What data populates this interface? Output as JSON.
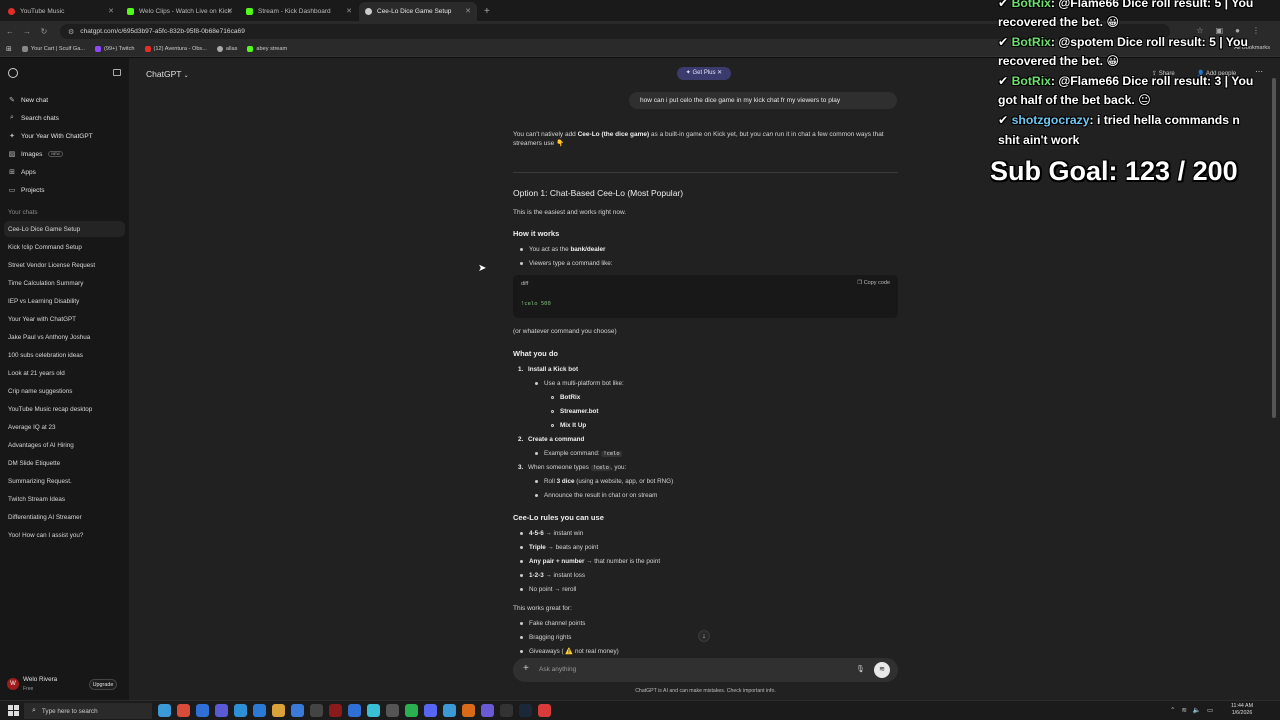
{
  "browser": {
    "tabs": [
      {
        "label": "YouTube Music",
        "color": "#e52d27",
        "active": false
      },
      {
        "label": "Welo Clips - Watch Live on Kick",
        "color": "#53fc18",
        "active": false
      },
      {
        "label": "Stream - Kick Dashboard",
        "color": "#53fc18",
        "active": false
      },
      {
        "label": "Cee-Lo Dice Game Setup",
        "color": "#cccccc",
        "active": true
      }
    ],
    "url": "chatgpt.com/c/695d3b97-a5fc-832b-95f8-0b68e716ca69",
    "bookmarks": [
      {
        "label": "Your Cart | Sculf Ga...",
        "color": "#888888"
      },
      {
        "label": "(99+) Twitch",
        "color": "#9146ff"
      },
      {
        "label": "(12) Aventura - Obs...",
        "color": "#e52d27"
      },
      {
        "label": "allas",
        "color": "#aaaaaa"
      },
      {
        "label": "abey stream",
        "color": "#53fc18"
      }
    ],
    "all_bookmarks": "All Bookmarks"
  },
  "sidebar": {
    "items": [
      {
        "label": "New chat",
        "icon": "edit-icon"
      },
      {
        "label": "Search chats",
        "icon": "search-icon"
      },
      {
        "label": "Your Year With ChatGPT",
        "icon": "sparkle-icon"
      },
      {
        "label": "Images",
        "icon": "image-icon",
        "badge": "NEW"
      },
      {
        "label": "Apps",
        "icon": "apps-icon"
      },
      {
        "label": "Projects",
        "icon": "folder-icon"
      }
    ],
    "section_label": "Your chats",
    "chats": [
      "Cee-Lo Dice Game Setup",
      "Kick !clip Command Setup",
      "Street Vendor License Request",
      "Time Calculation Summary",
      "IEP vs Learning Disability",
      "Your Year with ChatGPT",
      "Jake Paul vs Anthony Joshua",
      "100 subs celebration ideas",
      "Look at 21 years old",
      "Crip name suggestions",
      "YouTube Music recap desktop",
      "Average IQ at 23",
      "Advantages of AI Hiring",
      "DM Slide Etiquette",
      "Summarizing Request.",
      "Twitch Stream Ideas",
      "Differentiating AI Streamer",
      "Yoo! How can I assist you?"
    ],
    "user": {
      "name": "Welo Rivera",
      "plan": "Free",
      "upgrade": "Upgrade"
    }
  },
  "header": {
    "model": "ChatGPT",
    "get_plus": "Get Plus",
    "share": "Share",
    "add_people": "Add people"
  },
  "conversation": {
    "user_message": "how can i put celo the dice game in my kick chat fr my viewers to play",
    "intro_1": "You can't natively add ",
    "intro_bold": "Cee-Lo (the dice game)",
    "intro_2": " as a built-in game on Kick yet, but you ",
    "intro_em": "can",
    "intro_3": " run it in chat a few common ways that streamers use 👇",
    "option1_title": "Option 1: Chat-Based Cee-Lo (Most Popular)",
    "option1_sub": "This is the easiest and works right now.",
    "how_title": "How it works",
    "how_1a": "You act as the ",
    "how_1b": "bank/dealer",
    "how_2": "Viewers type a command like:",
    "code_lang": "diff",
    "copy_code": "Copy code",
    "code_text": "!celo 500",
    "after_code": "(or whatever command you choose)",
    "what_title": "What you do",
    "step1": "Install a Kick bot",
    "step1_sub": "Use a multi-platform bot like:",
    "bots": [
      "BotRix",
      "Streamer.bot",
      "Mix It Up"
    ],
    "step2": "Create a command",
    "step2_sub": "Example command: ",
    "step2_code": "!celo",
    "step3a": "When someone types ",
    "step3_code": "!celo",
    "step3b": ", you:",
    "step3_sub1a": "Roll ",
    "step3_sub1b": "3 dice",
    "step3_sub1c": " (using a website, app, or bot RNG)",
    "step3_sub2": "Announce the result in chat or on stream",
    "rules_title": "Cee-Lo rules you can use",
    "rules": [
      {
        "bold": "4-5-6",
        "rest": " → instant win"
      },
      {
        "bold": "Triple",
        "rest": " → beats any point"
      },
      {
        "bold": "Any pair + number",
        "rest": " → that number is the point"
      },
      {
        "bold": "1-2-3",
        "rest": " → instant loss"
      },
      {
        "bold": "",
        "rest": "No point → reroll"
      }
    ],
    "works_for": "This works great for:",
    "works_items": [
      "Fake channel points",
      "Bragging rights",
      "Giveaways ( ⚠️ not real money)"
    ]
  },
  "composer": {
    "placeholder": "Ask anything"
  },
  "disclaimer": "ChatGPT is AI and can make mistakes. Check important info.",
  "stream_overlay": {
    "lines": [
      {
        "user": "BotRix",
        "text": "@Flame66 Dice roll result: 5 | You"
      },
      {
        "user": "",
        "text": "recovered the bet. 😀"
      },
      {
        "user": "BotRix",
        "text": "@spotem Dice roll result: 5 | You"
      },
      {
        "user": "",
        "text": "recovered the bet. 😀"
      },
      {
        "user": "BotRix",
        "text": "@Flame66 Dice roll result: 3 | You"
      },
      {
        "user": "",
        "text": "got half of the bet back. 😐"
      },
      {
        "user": "shotzgocrazy",
        "text": "i tried hella commands n"
      },
      {
        "user": "",
        "text": "shit ain't work"
      }
    ],
    "sub_goal_label": "Sub Goal:",
    "sub_current": "123",
    "sub_target": "200"
  },
  "taskbar": {
    "search": "Type here to search",
    "time": "11:44 AM",
    "date": "1/6/2026"
  }
}
